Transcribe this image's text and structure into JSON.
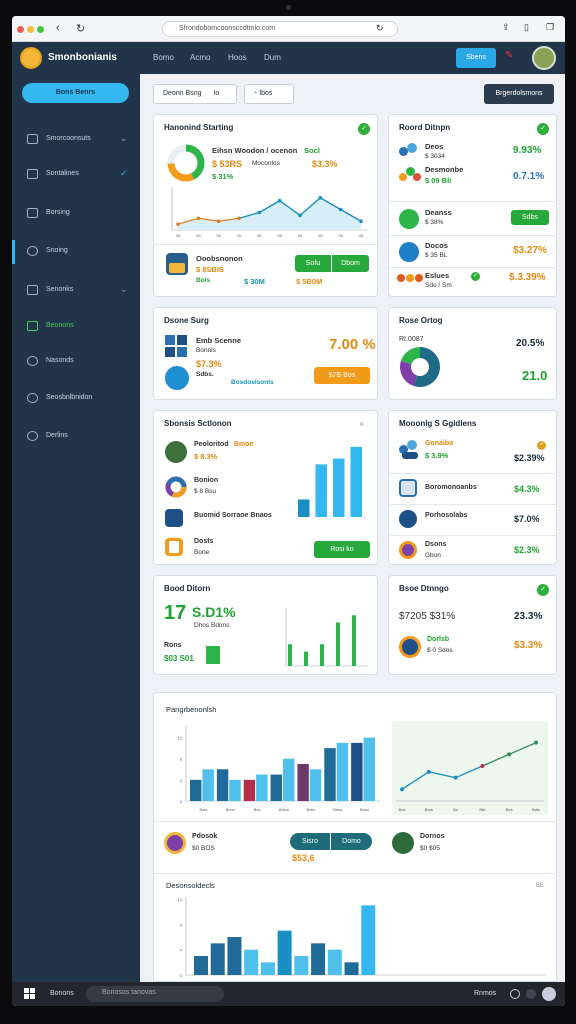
{
  "browser": {
    "url": "Sfrondobomcoonsccdtmlo.com"
  },
  "header": {
    "title": "Smonbonianis",
    "nav": [
      "Bomo",
      "Acmo",
      "Hoos",
      "Dum"
    ],
    "button": "Sbens"
  },
  "sidebar": {
    "cta": "Bons Benrs",
    "items": [
      {
        "label": "Smorcoonsuts",
        "chevron": "⌄"
      },
      {
        "label": "Sontalines",
        "chevron": "✓"
      },
      {
        "label": "Borsing",
        "chevron": ""
      },
      {
        "label": "Snoing",
        "chevron": ""
      },
      {
        "label": "Senonks",
        "chevron": "⌄"
      },
      {
        "label": "Beonons",
        "chevron": ""
      },
      {
        "label": "Nasonds",
        "chevron": ""
      },
      {
        "label": "Seosbnlbnidon",
        "chevron": ""
      },
      {
        "label": "Derlins",
        "chevron": ""
      }
    ]
  },
  "toolbar": {
    "select": "Deonn Bsng",
    "select_suffix": "Io",
    "search": "Ibos",
    "action": "Brgerdolsmons"
  },
  "card1": {
    "title": "Hanonind Starting",
    "line1": "Eihsn Woodon / ocenon",
    "line1b": "Socl",
    "v1": "$ 53RS",
    "v1b": "Moconlos",
    "v1c": "$3.3%",
    "v2": "$ 31%",
    "chart": {
      "type": "line",
      "x": [
        "06",
        "06",
        "06",
        "06",
        "06",
        "06",
        "06",
        "06",
        "06",
        "06"
      ],
      "y": [
        2,
        4,
        3,
        4,
        6,
        10,
        5,
        11,
        7,
        3
      ],
      "ylim": [
        0,
        14
      ]
    },
    "item": "Ooobsnonon",
    "item_v": "$ 8SBIS",
    "item_a": "Bois",
    "item_b": "$ 30M",
    "item_c": "$ 5B0M",
    "btn1": "Sofu",
    "btn2": "Dbom"
  },
  "card2": {
    "title": "Roord Ditnpn",
    "rows": [
      {
        "label": "Deos",
        "sub": "$ 3034",
        "value": "9.93%"
      },
      {
        "label": "Desmonbe",
        "sub": "$ 09 Bli",
        "value": "0.7.1%"
      },
      {
        "label": "Deanss",
        "sub": "$ 38%",
        "btn": "Sdbs"
      },
      {
        "label": "Docos",
        "sub": "$ 35 BL",
        "value": "$3.27%"
      },
      {
        "label": "Eslues",
        "sub": "Sdo / Sm",
        "value": "$.3.39%"
      }
    ]
  },
  "card3": {
    "title": "Dsone Surg",
    "l1": "Emb Scenne",
    "l1b": "Bonnis",
    "l2": "$7.3%",
    "l3": "Sdbs.",
    "l3b": "Bosdoslsonls",
    "value": "7.00 %",
    "btn": "$7B Bos"
  },
  "card4": {
    "title": "Rose Ortog",
    "label": "RI.0087",
    "v1": "20.5%",
    "v2": "21.0",
    "chart_data": {
      "type": "pie",
      "values": [
        55,
        25,
        20
      ],
      "colors": [
        "#1f6a86",
        "#7d3fa8",
        "#2db54a"
      ]
    }
  },
  "card5": {
    "title": "Sbonsis Sctlonon",
    "rows": [
      {
        "label": "Peoloritod",
        "tag": "Bmoe",
        "sub": "$ 8.3%"
      },
      {
        "label": "Bonion",
        "sub": "$ 8 Bsu"
      },
      {
        "label": "Buomid Sorraoe Bnaos",
        "sub": ""
      },
      {
        "label": "Dosts",
        "sub": "Bone"
      }
    ],
    "btn": "Rosi ko",
    "chart_data": {
      "type": "bar",
      "values": [
        3,
        9,
        10,
        12
      ],
      "ylim": [
        0,
        13
      ]
    }
  },
  "card6": {
    "title": "Mooonlg S Ggidlens",
    "rows": [
      {
        "label": "Gonaiba",
        "sub": "$ 3.9%",
        "value": "$2.39%"
      },
      {
        "label": "Boromonoanbs",
        "sub": "",
        "value": "$4.3%"
      },
      {
        "label": "Porhosolabs",
        "sub": "",
        "value": "$7.0%"
      },
      {
        "label": "Dsons",
        "sub": "Gbon",
        "value": "$2.3%"
      }
    ]
  },
  "card7": {
    "title": "Bood Ditorn",
    "big1": "17",
    "big2": "S.D1%",
    "sub": "Dhos Bdons",
    "l1": "Rons",
    "l2": "$03 S01",
    "chart_data": {
      "type": "bar",
      "values": [
        3,
        2,
        3,
        6,
        7
      ],
      "ylim": [
        0,
        8
      ]
    }
  },
  "card8": {
    "title": "Bsoe Dtnngo",
    "v1": "$7205 $31%",
    "v1b": "23.3%",
    "l1": "Dorlsb",
    "l1b": "$ 0 Sdos",
    "v2": "$3.3%"
  },
  "panel": {
    "title": "Pangrbenonlsh",
    "chart_data": {
      "type": "bar",
      "categories": [
        "Bols",
        "Bons",
        "Bos",
        "Bdlos",
        "Bolis",
        "Bdns",
        "Bdos"
      ],
      "series": [
        {
          "values": [
            4,
            6,
            4,
            5,
            7,
            10,
            11
          ],
          "color": "#1f6a96"
        },
        {
          "values": [
            6,
            4,
            5,
            8,
            6,
            11,
            12
          ],
          "color": "#4fc0ec"
        }
      ],
      "ylim": [
        0,
        14
      ]
    },
    "line": {
      "type": "line",
      "x": [
        "Bsd",
        "Bors",
        "Bo",
        "Bbt",
        "Bos",
        "Bdls"
      ],
      "y": [
        2,
        5,
        4,
        6,
        8,
        10
      ],
      "ylim": [
        0,
        12
      ]
    },
    "p1": "Pdosok",
    "p1b": "$0 BOS",
    "p1v": "$53,6",
    "btn1": "Sisro",
    "btn2": "Domo",
    "p2": "Dornos",
    "p2b": "$0 $05"
  },
  "panel2": {
    "title": "Desonsoldecls",
    "tag": "Bb",
    "chart_data": {
      "type": "bar",
      "values": [
        3,
        5,
        6,
        4,
        2,
        7,
        3,
        5,
        4,
        2,
        11
      ],
      "ylim": [
        0,
        12
      ]
    }
  },
  "taskbar": {
    "search": "Bonosos tanovas",
    "label": "Bonons",
    "right": "Rnmos"
  }
}
